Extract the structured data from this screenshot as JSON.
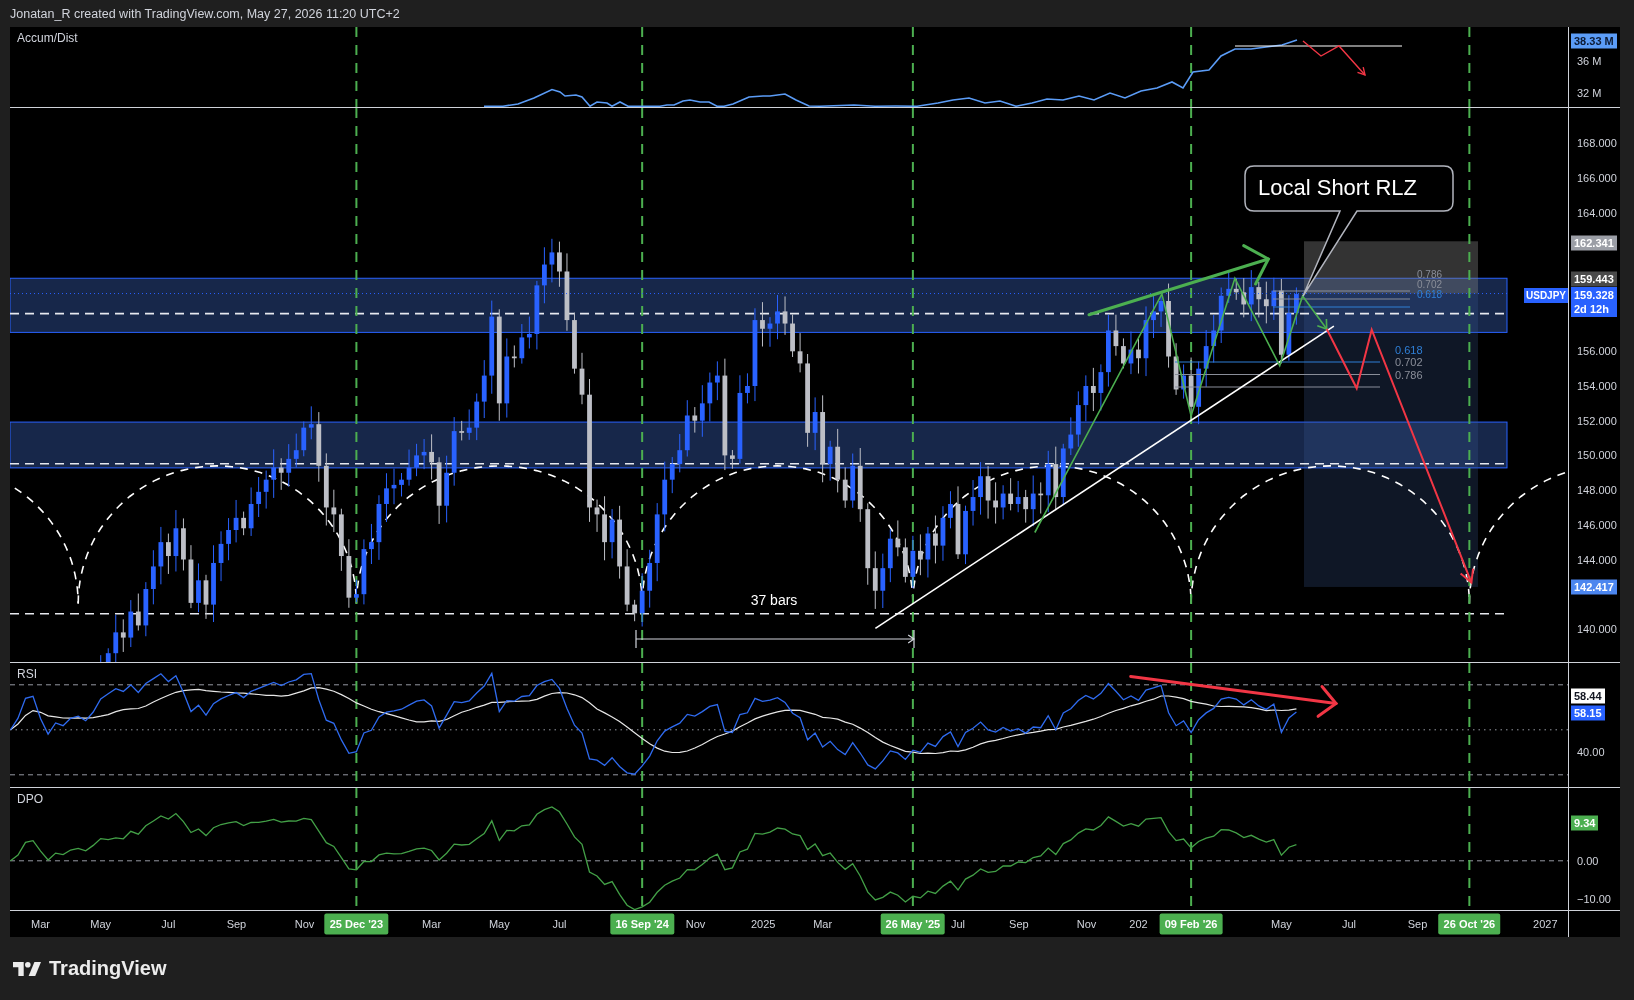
{
  "header": {
    "caption": "Jonatan_R created with TradingView.com, May 27, 2026 11:20 UTC+2"
  },
  "accum_dist": {
    "title": "Accum/Dist",
    "axis_ticks": [
      "36 M",
      "32 M"
    ],
    "value_label": "38.33 M"
  },
  "price_panel": {
    "symbol": "USDJPY",
    "axis_ticks": [
      "168.000",
      "166.000",
      "164.000",
      "156.000",
      "154.000",
      "152.000",
      "150.000",
      "148.000",
      "146.000",
      "144.000",
      "140.000"
    ],
    "price_labels": [
      {
        "kind": "stop",
        "text": "162.341"
      },
      {
        "kind": "high",
        "text": "159.443"
      },
      {
        "kind": "last",
        "text": "159.328",
        "countdown": "2d 12h"
      },
      {
        "kind": "target",
        "text": "142.417"
      }
    ],
    "callout": "Local Short RLZ",
    "bars_label": "37 bars",
    "fib_upper": [
      {
        "label": "0.786",
        "color": "#8a8e99"
      },
      {
        "label": "0.702",
        "color": "#8a8e99"
      },
      {
        "label": "0.618",
        "color": "#2f7fd6"
      }
    ],
    "fib_lower": [
      {
        "label": "0.618",
        "color": "#2f7fd6"
      },
      {
        "label": "0.702",
        "color": "#8a8e99"
      },
      {
        "label": "0.786",
        "color": "#8a8e99"
      }
    ]
  },
  "rsi": {
    "title": "RSI",
    "axis_ticks": [
      "40.00"
    ],
    "value_labels": [
      {
        "kind": "average",
        "text": "58.44"
      },
      {
        "kind": "rsi",
        "text": "58.15"
      }
    ]
  },
  "dpo": {
    "title": "DPO",
    "axis_ticks": [
      "0.00",
      "−10.00"
    ],
    "value_label": "9.34"
  },
  "time_axis": [
    {
      "text": "Mar",
      "kind": "tick"
    },
    {
      "text": "May",
      "kind": "tick"
    },
    {
      "text": "Jul",
      "kind": "tick"
    },
    {
      "text": "Sep",
      "kind": "tick"
    },
    {
      "text": "Nov",
      "kind": "tick"
    },
    {
      "text": "25 Dec '23",
      "kind": "marker"
    },
    {
      "text": "Mar",
      "kind": "tick"
    },
    {
      "text": "May",
      "kind": "tick"
    },
    {
      "text": "Jul",
      "kind": "tick"
    },
    {
      "text": "16 Sep '24",
      "kind": "marker"
    },
    {
      "text": "Nov",
      "kind": "tick"
    },
    {
      "text": "2025",
      "kind": "tick"
    },
    {
      "text": "Mar",
      "kind": "tick"
    },
    {
      "text": "26 May '25",
      "kind": "marker"
    },
    {
      "text": "Jul",
      "kind": "tick"
    },
    {
      "text": "Sep",
      "kind": "tick"
    },
    {
      "text": "Nov",
      "kind": "tick"
    },
    {
      "text": "202",
      "kind": "tick"
    },
    {
      "text": "09 Feb '26",
      "kind": "marker"
    },
    {
      "text": "May",
      "kind": "tick"
    },
    {
      "text": "Jul",
      "kind": "tick"
    },
    {
      "text": "Sep",
      "kind": "tick"
    },
    {
      "text": "26 Oct '26",
      "kind": "marker"
    },
    {
      "text": "2027",
      "kind": "tick"
    }
  ],
  "footer": {
    "brand": "TradingView"
  }
}
